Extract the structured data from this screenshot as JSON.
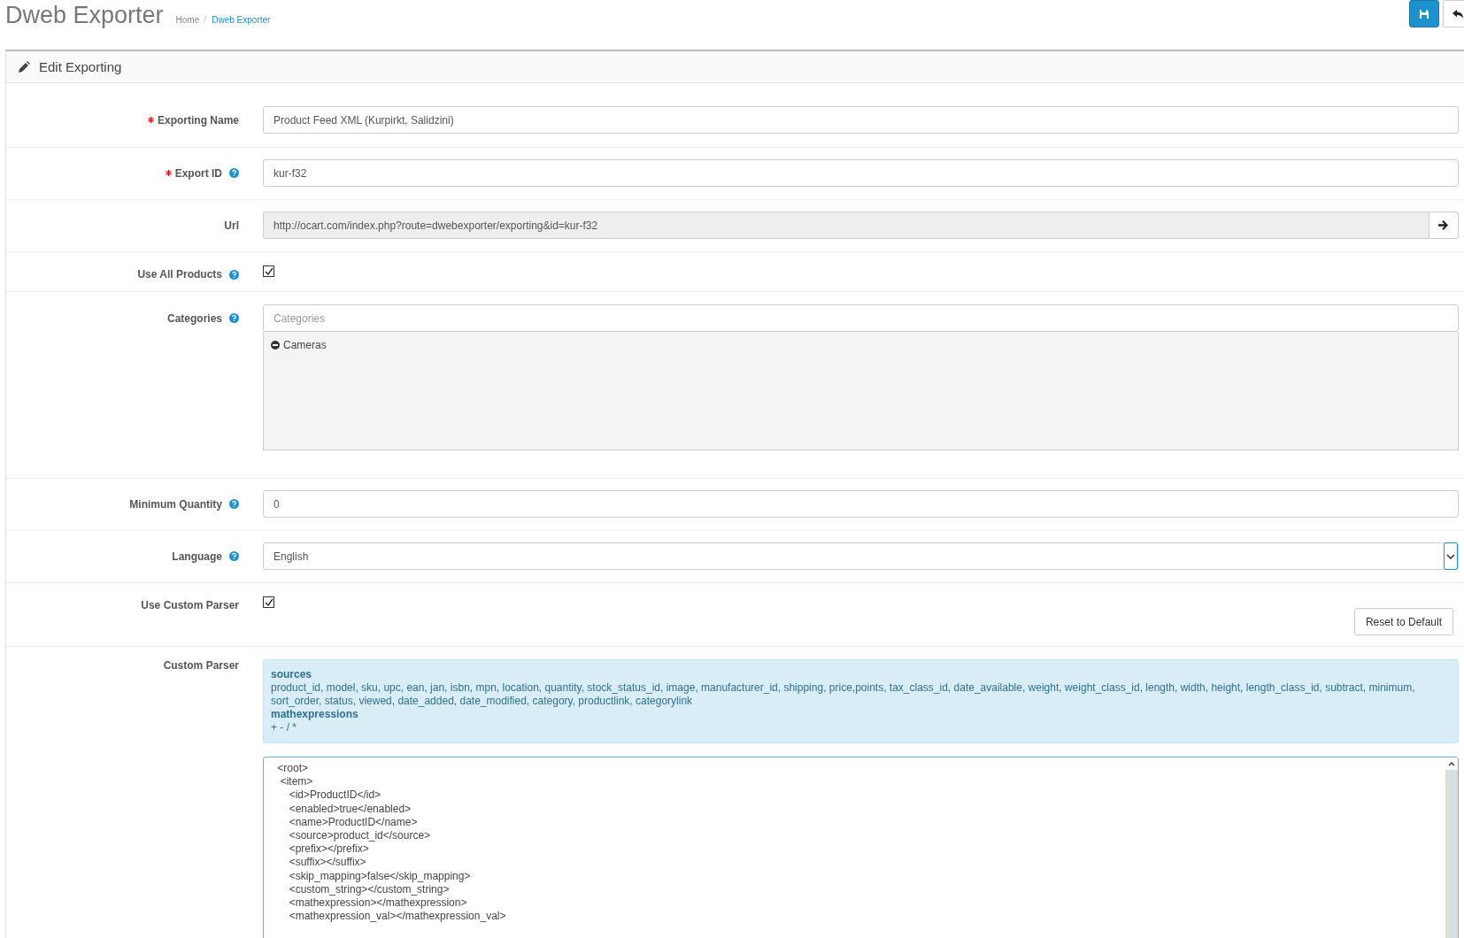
{
  "header": {
    "title": "Dweb Exporter",
    "breadcrumb": [
      {
        "label": "Home",
        "selected": false
      },
      {
        "label": "Dweb Exporter",
        "selected": true
      }
    ]
  },
  "panel": {
    "title": "Edit Exporting",
    "fields": [
      {
        "kind": "text",
        "label": "Exporting Name",
        "required": true,
        "help": false,
        "value": "Product Feed XML (Kurpirkt, Salidzini)"
      },
      {
        "kind": "text",
        "label": "Export ID",
        "required": true,
        "help": true,
        "value": "kur-f32"
      },
      {
        "kind": "url",
        "label": "Url",
        "required": false,
        "help": false,
        "value": "http://ocart.com/index.php?route=dwebexporter/exporting&id=kur-f32"
      },
      {
        "kind": "checkbox",
        "label": "Use All Products",
        "required": false,
        "help": true,
        "checked": true
      },
      {
        "kind": "categories",
        "label": "Categories",
        "required": false,
        "help": true,
        "placeholder": "Categories",
        "items": [
          "Cameras"
        ]
      },
      {
        "kind": "text",
        "label": "Minimum Quantity",
        "required": false,
        "help": true,
        "value": "0"
      },
      {
        "kind": "select",
        "label": "Language",
        "required": false,
        "help": true,
        "value": "English"
      },
      {
        "kind": "checkbox",
        "label": "Use Custom Parser",
        "required": false,
        "help": false,
        "checked": true,
        "button": "Reset to Default"
      },
      {
        "kind": "parser",
        "label": "Custom Parser",
        "required": false,
        "help": false,
        "info": [
          {
            "kind": "heading",
            "text": "sources"
          },
          {
            "kind": "text",
            "text": "product_id, model, sku, upc, ean, jan, isbn, mpn, location, quantity, stock_status_id, image, manufacturer_id, shipping, price,points, tax_class_id, date_available, weight, weight_class_id, length, width, height, length_class_id, subtract, minimum, sort_order, status, viewed, date_added, date_modified, category, productlink, categorylink"
          },
          {
            "kind": "heading",
            "text": "mathexpressions"
          },
          {
            "kind": "text",
            "text": "+ - / *"
          }
        ],
        "code": [
          " <root>",
          "  <item>",
          "     <id>ProductID</id>",
          "     <enabled>true</enabled>",
          "     <name>ProductID</name>",
          "     <source>product_id</source>",
          "     <prefix></prefix>",
          "     <suffix></suffix>",
          "     <skip_mapping>false</skip_mapping>",
          "     <custom_string></custom_string>",
          "     <mathexpression></mathexpression>",
          "     <mathexpression_val></mathexpression_val>"
        ]
      }
    ]
  }
}
